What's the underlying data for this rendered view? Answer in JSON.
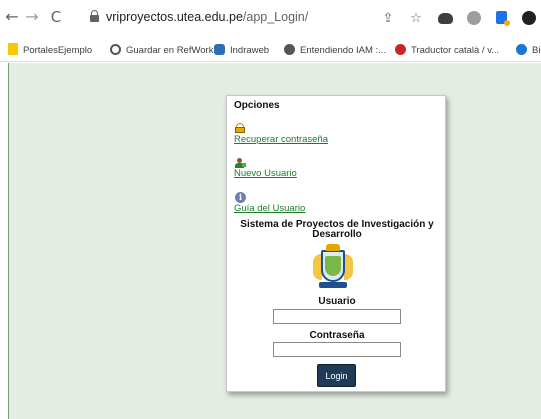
{
  "browser": {
    "url_host": "vriproyectos.utea.edu.pe",
    "url_path": "/app_Login/",
    "nav": {
      "back": "←",
      "forward": "→",
      "reload": "C"
    },
    "share_glyph": "⇪",
    "star_glyph": "☆"
  },
  "bookmarks": [
    {
      "label": "PortalesEjemplo",
      "icon": "folder-icon"
    },
    {
      "label": "Guardar en RefWorks",
      "icon": "refworks-icon"
    },
    {
      "label": "Indraweb",
      "icon": "indraweb-icon"
    },
    {
      "label": "Entendiendo IAM :...",
      "icon": "iam-icon"
    },
    {
      "label": "Traductor català / v...",
      "icon": "translator-icon"
    },
    {
      "label": "Bien",
      "icon": "site-icon"
    }
  ],
  "login": {
    "options_title": "Opciones",
    "recover_link": "Recuperar contraseña",
    "new_user_link": "Nuevo Usuario",
    "guide_link": "Guía del Usuario",
    "info_glyph": "i",
    "system_title": "Sistema de Proyectos de Investigación y Desarrollo",
    "user_label": "Usuario",
    "user_value": "",
    "password_label": "Contraseña",
    "password_value": "",
    "login_button": "Login"
  },
  "colors": {
    "page_background": "#e3ede3",
    "link": "#1a7d2a",
    "login_button": "#1f3b55"
  }
}
